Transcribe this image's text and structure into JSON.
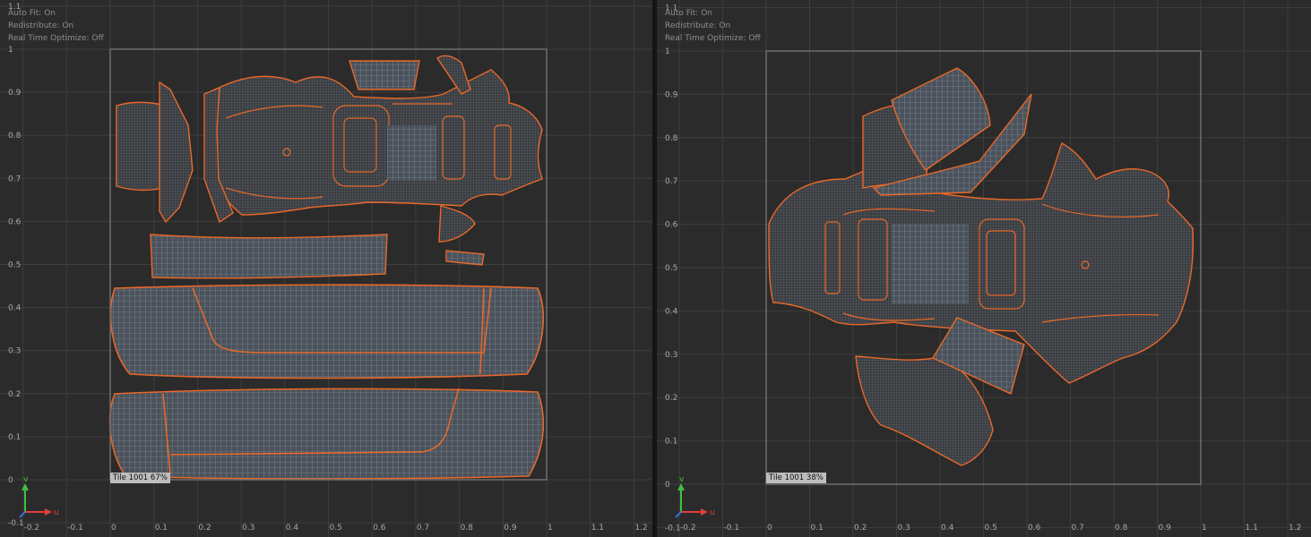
{
  "left_viewport": {
    "overlay": {
      "auto_fit": "Auto Fit: On",
      "redistribute": "Redistribute: On",
      "real_time_optimize": "Real Time Optimize: Off"
    },
    "tile_label": "Tile 1001 67%",
    "u_ticks": [
      "-0.2",
      "-0.1",
      "0",
      "0.1",
      "0.2",
      "0.3",
      "0.4",
      "0.5",
      "0.6",
      "0.7",
      "0.8",
      "0.9",
      "1",
      "1.1",
      "1.2"
    ],
    "v_ticks": [
      "1.1",
      "1",
      "0.9",
      "0.8",
      "0.7",
      "0.6",
      "0.5",
      "0.4",
      "0.3",
      "0.2",
      "0.1",
      "0",
      "-0.1"
    ]
  },
  "right_viewport": {
    "overlay": {
      "auto_fit": "Auto Fit: On",
      "redistribute": "Redistribute: On",
      "real_time_optimize": "Real Time Optimize: Off"
    },
    "tile_label": "Tile 1001 38%",
    "u_ticks": [
      "-0.2",
      "-0.1",
      "0",
      "0.1",
      "0.2",
      "0.3",
      "0.4",
      "0.5",
      "0.6",
      "0.7",
      "0.8",
      "0.9",
      "1",
      "1.1",
      "1.2"
    ],
    "v_ticks": [
      "1.1",
      "1",
      "0.9",
      "0.8",
      "0.7",
      "0.6",
      "0.5",
      "0.4",
      "0.3",
      "0.2",
      "0.1",
      "0",
      "-0.1"
    ]
  },
  "axis_gizmo": {
    "v_label": "v",
    "u_label": "u"
  },
  "colors": {
    "background": "#2b2b2b",
    "grid": "#3e3e3e",
    "tile_border": "#6e6e6e",
    "uv_seam": "#e8682a",
    "mesh_fill": "#4a5058",
    "mesh_line": "#8a94a0",
    "axis_v": "#3ec23e",
    "axis_u": "#e23c3c"
  }
}
